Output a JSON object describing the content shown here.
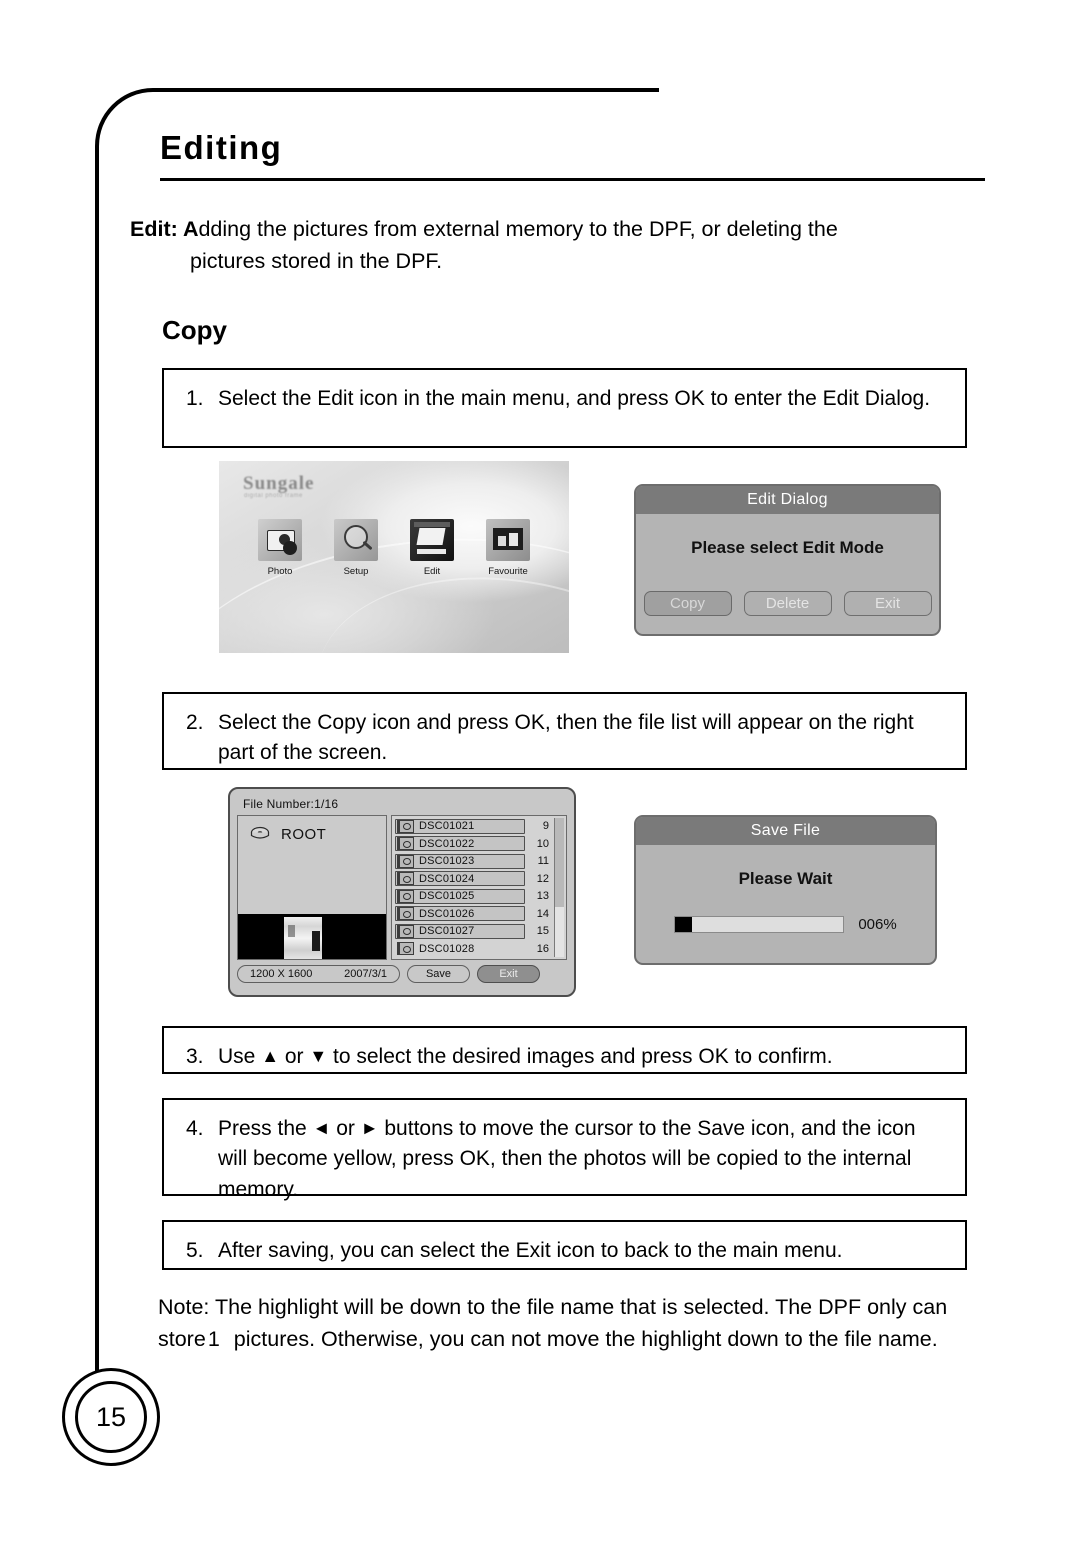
{
  "document": {
    "heading": "Editing",
    "page_number": "15",
    "intro": {
      "lead": "Edit: A",
      "line1_rest": "dding the pictures from external memory to the DPF, or deleting the",
      "line2": "pictures stored in the  DPF."
    },
    "section_title": "Copy"
  },
  "steps": [
    {
      "num": "1.",
      "text": "Select the Edit icon in the main menu, and press OK to enter the Edit Dialog."
    },
    {
      "num": "2.",
      "text": "Select the Copy icon and press OK, then the file list will appear on the right part of the screen."
    },
    {
      "num": "3.",
      "prefix": "Use ",
      "up_arrow": "▲",
      "mid": " or ",
      "down_arrow": "▼",
      "suffix": " to select the desired images and press OK to confirm."
    },
    {
      "num": "4.",
      "prefix": "Press the ",
      "left_arrow": "◄",
      "mid": " or ",
      "right_arrow": "►",
      "suffix": " buttons to move the cursor to the Save icon, and the icon will become yellow, press OK, then the photos will be copied to the internal memory."
    },
    {
      "num": "5.",
      "text": "After saving, you can select the Exit icon to back to the main menu."
    }
  ],
  "note": {
    "part1": "Note: The highlight will be down to the file name that is selected. The DPF only can store",
    "count": "1",
    "part2": "pictures.  Otherwise, you can not move the highlight down to the file name."
  },
  "main_menu_screen": {
    "logo": "Sungale",
    "logo_sub": "digital photo frame",
    "items": [
      {
        "label": "Photo",
        "icon": "camera-icon"
      },
      {
        "label": "Setup",
        "icon": "magnifier-icon"
      },
      {
        "label": "Edit",
        "icon": "edit-page-icon"
      },
      {
        "label": "Favourite",
        "icon": "favourite-icon"
      }
    ]
  },
  "edit_dialog": {
    "title": "Edit Dialog",
    "message": "Please select Edit Mode",
    "buttons": [
      {
        "label": "Copy",
        "selected": true
      },
      {
        "label": "Delete",
        "selected": false
      },
      {
        "label": "Exit",
        "selected": false
      }
    ]
  },
  "file_browser": {
    "header": "File  Number:1/16",
    "root_label": "ROOT",
    "root_icon": "drive-icon",
    "files": [
      {
        "name": "DSC01021",
        "index": "9"
      },
      {
        "name": "DSC01022",
        "index": "10"
      },
      {
        "name": "DSC01023",
        "index": "11"
      },
      {
        "name": "DSC01024",
        "index": "12"
      },
      {
        "name": "DSC01025",
        "index": "13"
      },
      {
        "name": "DSC01026",
        "index": "14"
      },
      {
        "name": "DSC01027",
        "index": "15"
      },
      {
        "name": "DSC01028",
        "index": "16"
      }
    ],
    "footer": {
      "resolution": "1200 X 1600",
      "date": "2007/3/1",
      "save_label": "Save",
      "exit_label": "Exit",
      "exit_active": true
    }
  },
  "save_dialog": {
    "title": "Save File",
    "message": "Please Wait",
    "percent_label": "006%",
    "percent_value": 6
  },
  "colors": {
    "osd_body": "#b4b4b4",
    "osd_titlebar": "#7a7a7a",
    "osd_title_text": "#ffffff",
    "progress_fill": "#000000",
    "page_ink": "#000000"
  }
}
